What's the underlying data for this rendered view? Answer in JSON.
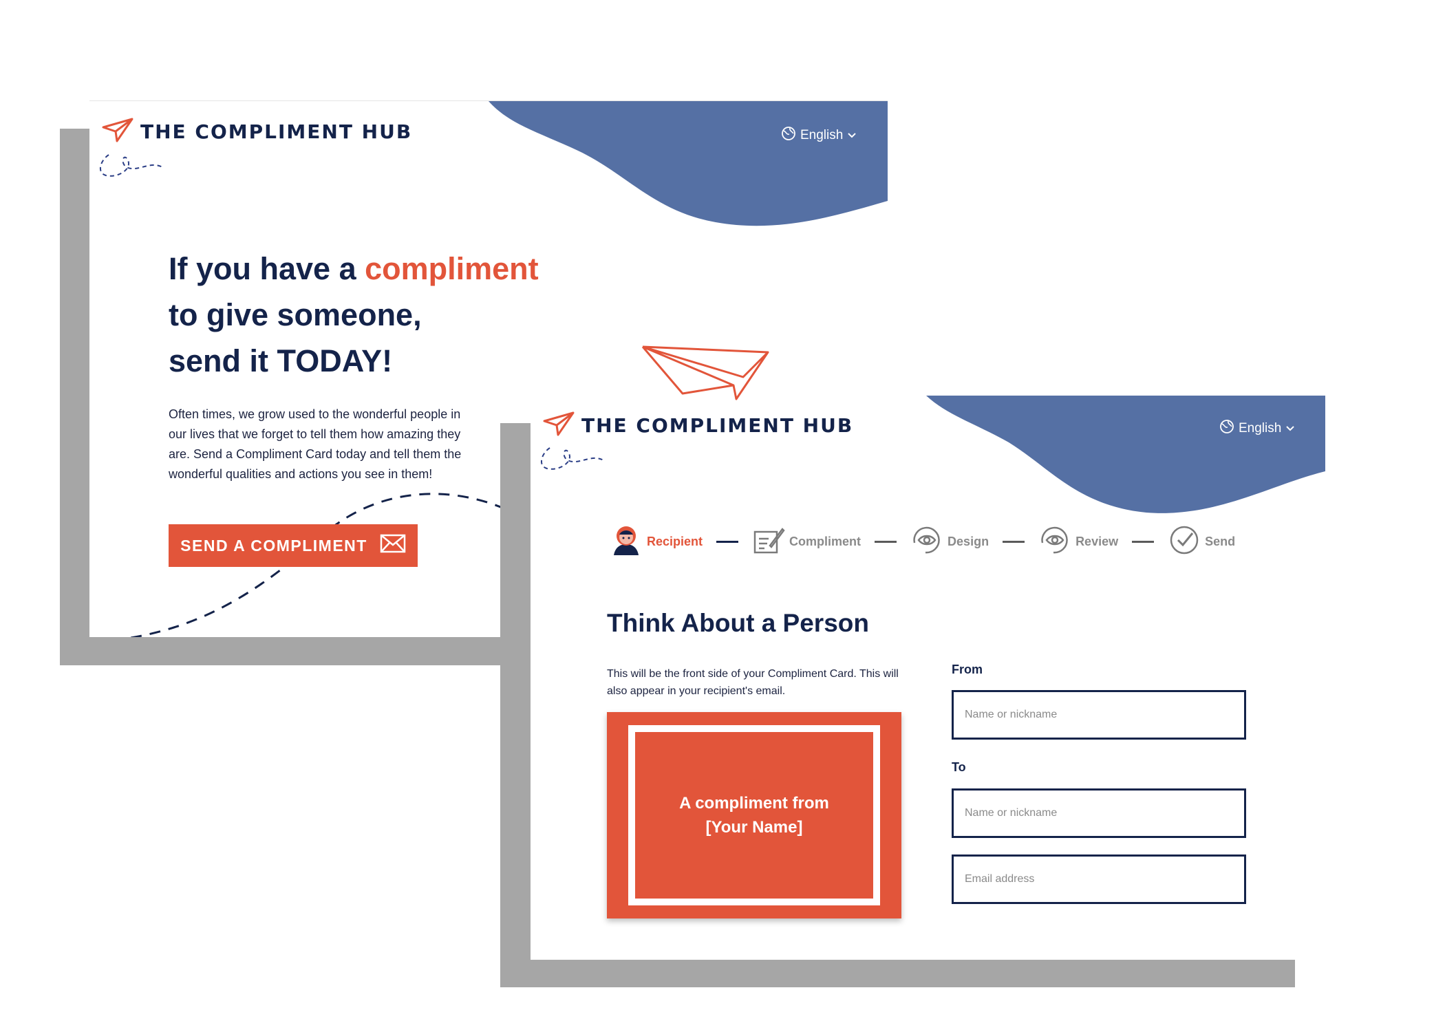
{
  "colors": {
    "navy": "#14234a",
    "accent": "#e2553a",
    "wave": "#5570a4",
    "shadow": "#a6a6a6"
  },
  "landing": {
    "logo_text": "THE COMPLIMENT HUB",
    "logo_icon": "paper-plane-icon",
    "language": "English",
    "headline_part1": "If you have a ",
    "headline_accent": "compliment",
    "headline_line2": "to give someone,",
    "headline_line3": "send it TODAY!",
    "blurb": "Often times, we grow used to the wonderful people in our lives that we forget to tell them how amazing they are. Send a Compliment Card today and tell them the wonderful qualities and actions you see in them!",
    "cta_label": "SEND A COMPLIMENT",
    "cta_icon": "envelope-icon"
  },
  "wizard": {
    "logo_text": "THE COMPLIMENT HUB",
    "language": "English",
    "steps": [
      {
        "label": "Recipient",
        "icon": "person-icon",
        "active": true
      },
      {
        "label": "Compliment",
        "icon": "pencil-note-icon",
        "active": false
      },
      {
        "label": "Design",
        "icon": "eye-icon",
        "active": false
      },
      {
        "label": "Review",
        "icon": "eye-icon",
        "active": false
      },
      {
        "label": "Send",
        "icon": "check-circle-icon",
        "active": false
      }
    ],
    "title": "Think About a Person",
    "description": "This will be the front side of your Compliment Card. This will also appear in your recipient's email.",
    "card_line1": "A compliment from",
    "card_line2": "[Your Name]",
    "from_label": "From",
    "from_placeholder": "Name or nickname",
    "to_label": "To",
    "to_placeholder": "Name or nickname",
    "email_placeholder": "Email address"
  }
}
